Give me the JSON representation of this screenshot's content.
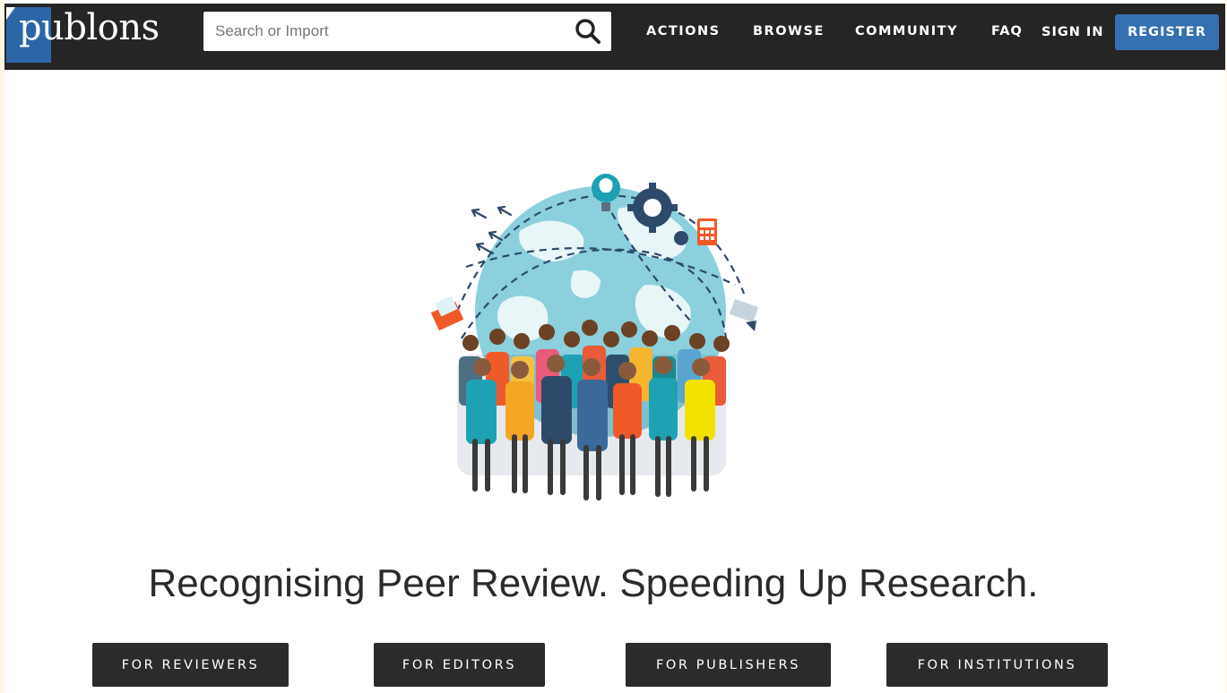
{
  "header": {
    "logo_text": "publons",
    "search": {
      "placeholder": "Search or Import",
      "value": ""
    },
    "nav": {
      "actions": "ACTIONS",
      "browse": "BROWSE",
      "community": "COMMUNITY",
      "faq": "FAQ",
      "sign_in": "SIGN IN",
      "register": "REGISTER"
    }
  },
  "hero": {
    "headline": "Recognising Peer Review. Speeding Up Research.",
    "buttons": {
      "reviewers": "FOR REVIEWERS",
      "editors": "FOR EDITORS",
      "publishers": "FOR PUBLISHERS",
      "institutions": "FOR INSTITUTIONS"
    }
  },
  "colors": {
    "navbar": "#252525",
    "brand_blue": "#2d66a6",
    "register": "#3571b0",
    "cta": "#2b2b2b",
    "globe": "#7fcbd8"
  },
  "icons": [
    "search-icon",
    "lightbulb-icon",
    "gear-icon",
    "calculator-icon",
    "envelope-icon",
    "chat-icon",
    "arrow-icon"
  ]
}
